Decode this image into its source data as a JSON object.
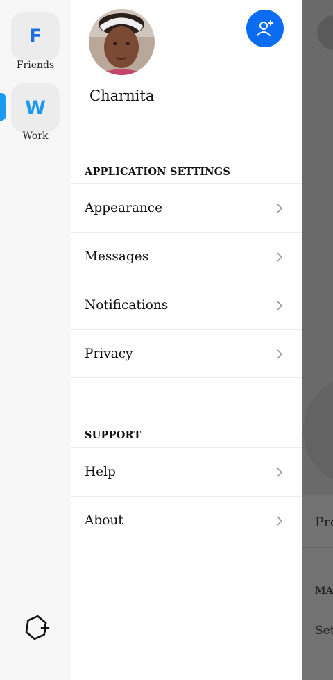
{
  "workspaces": [
    {
      "initial": "F",
      "label": "Friends",
      "color": "#1f6fe0"
    },
    {
      "initial": "W",
      "label": "Work",
      "color": "#1a9bf0"
    }
  ],
  "user": {
    "name": "Charnita"
  },
  "sections": {
    "application_settings": {
      "title": "APPLICATION SETTINGS",
      "items": [
        "Appearance",
        "Messages",
        "Notifications",
        "Privacy"
      ]
    },
    "support": {
      "title": "SUPPORT",
      "items": [
        "Help",
        "About"
      ]
    }
  },
  "background": {
    "row_text": "Pro",
    "section_text": "MA",
    "setting_text": "Set"
  },
  "colors": {
    "accent": "#0a6cf0",
    "active_indicator": "#1a9bf0",
    "overlay": "#6a6a6a"
  },
  "icons": [
    "add-friend-icon",
    "chevron-right-icon",
    "add-workspace-icon",
    "menu-icon"
  ]
}
